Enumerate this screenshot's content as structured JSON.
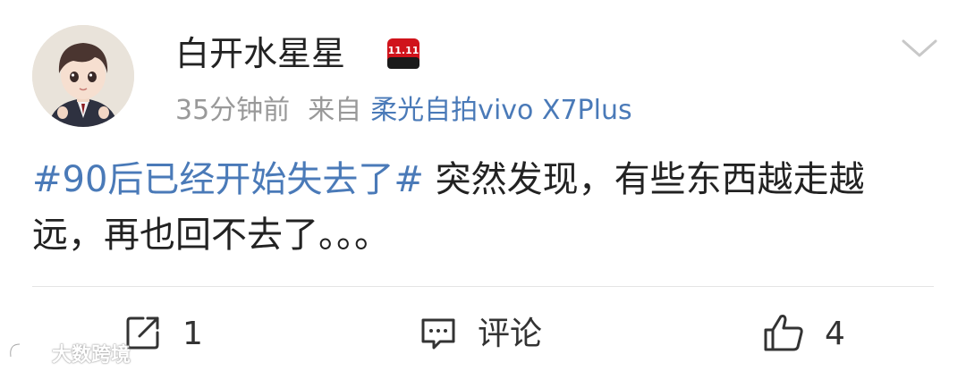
{
  "post": {
    "username": "白开水星星",
    "badge_text": "11.11",
    "time": "35分钟前",
    "from_label": "来自",
    "source": "柔光自拍vivo X7Plus",
    "topic": "#90后已经开始失去了#",
    "body": " 突然发现，有些东西越走越远，再也回不去了。。。"
  },
  "actions": {
    "share_count": "1",
    "comment_label": "评论",
    "like_count": "4"
  },
  "watermark": {
    "text": "大数跨境"
  },
  "icons": {
    "more": "chevron-down-icon",
    "share": "share-icon",
    "comment": "comment-icon",
    "like": "thumbs-up-icon"
  },
  "colors": {
    "link": "#4a7ab8",
    "meta": "#999999",
    "badge": "#d0131b"
  }
}
